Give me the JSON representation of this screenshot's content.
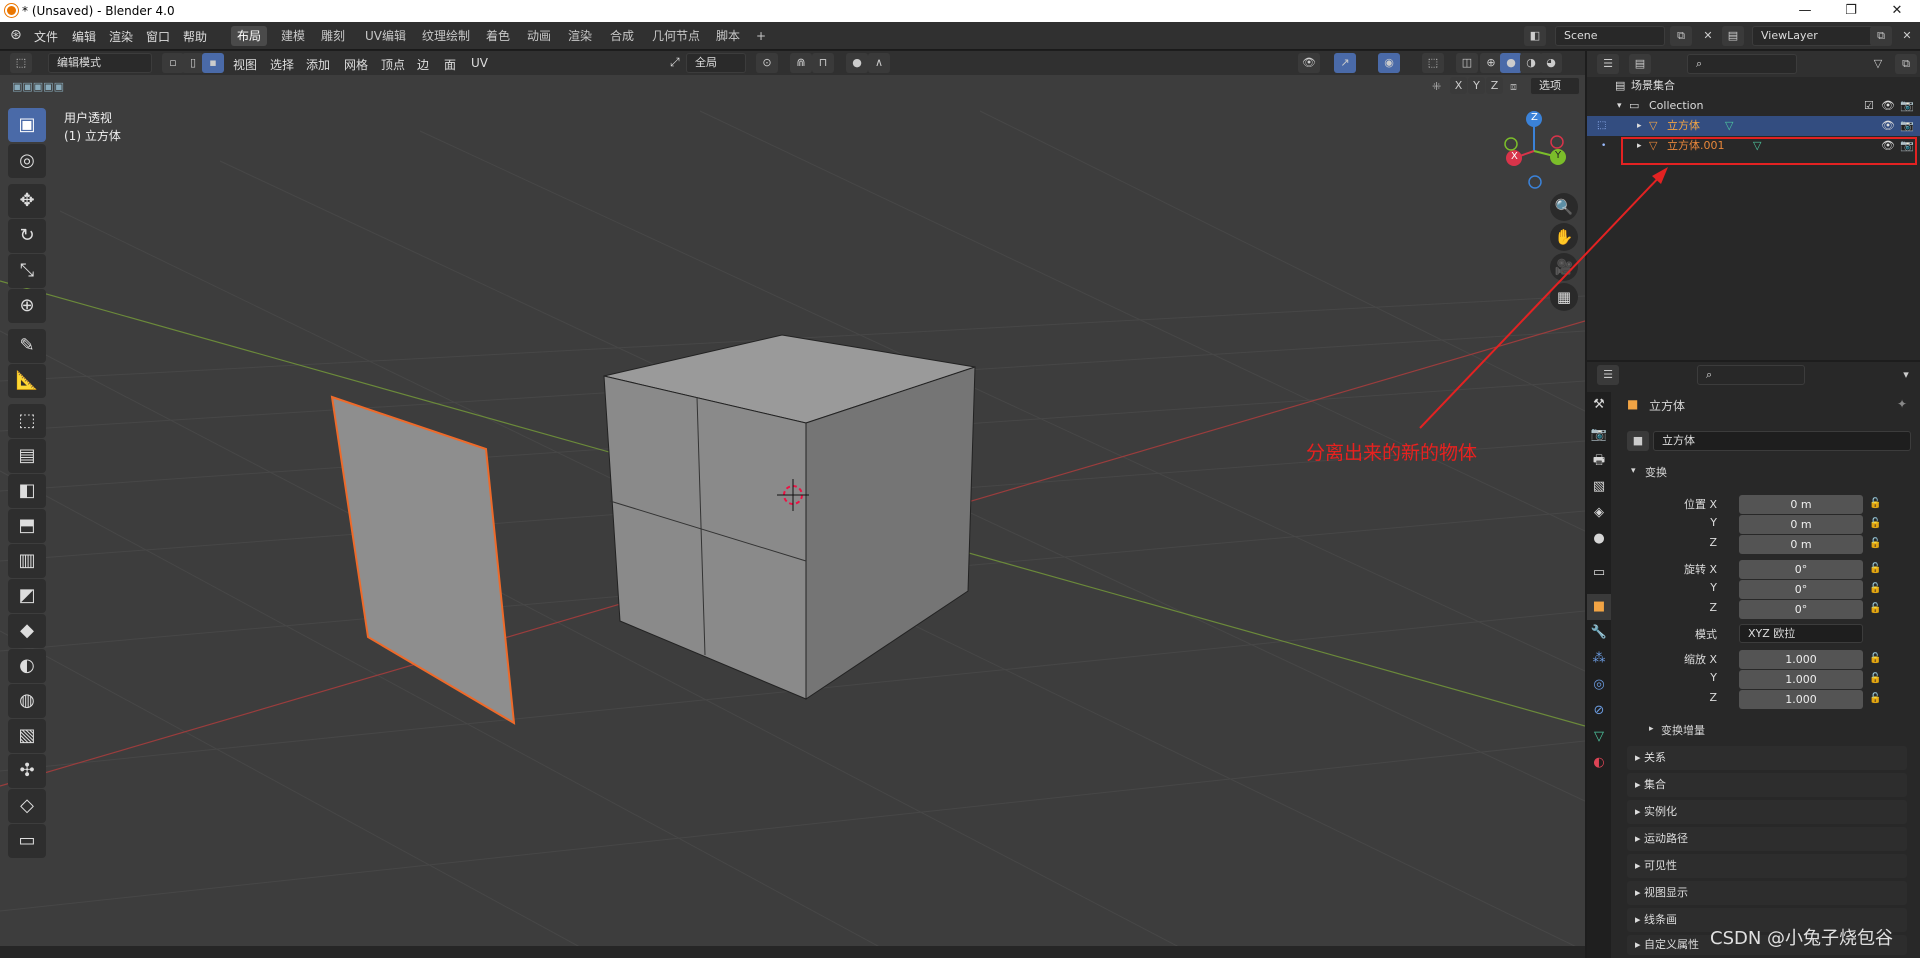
{
  "window": {
    "title": "* (Unsaved) - Blender 4.0",
    "min": "—",
    "max": "❐",
    "close": "✕"
  },
  "menus": [
    "文件",
    "编辑",
    "渲染",
    "窗口",
    "帮助"
  ],
  "workspaces": [
    "布局",
    "建模",
    "雕刻",
    "UV编辑",
    "纹理绘制",
    "着色",
    "动画",
    "渲染",
    "合成",
    "几何节点",
    "脚本",
    "+"
  ],
  "scene": {
    "name": "Scene",
    "view_layer": "ViewLayer"
  },
  "viewport_header": {
    "mode": "编辑模式",
    "menus": [
      "视图",
      "选择",
      "添加",
      "网格",
      "顶点",
      "边",
      "面",
      "UV"
    ],
    "transform_orientation": "全局",
    "options": "选项",
    "axes": [
      "X",
      "Y",
      "Z"
    ]
  },
  "viewport": {
    "view_name": "用户透视",
    "object_name": "(1) 立方体"
  },
  "gizmo": {
    "x": "X",
    "y": "Y",
    "z": "Z"
  },
  "tools": [
    "▣",
    "◎",
    "✥",
    "↻",
    "⤡",
    "⊕",
    "✎",
    "📐",
    "⬚",
    "▤",
    "◧",
    "⬒",
    "▥",
    "◩",
    "◆",
    "◐",
    "◍",
    "▧",
    "✣",
    "◇",
    "▭"
  ],
  "nav_icons": [
    "🔍",
    "✋",
    "🎥",
    "▦"
  ],
  "outliner": {
    "scene_collection": "场景集合",
    "collection": "Collection",
    "items": [
      {
        "name": "立方体",
        "color": "#f2a444"
      },
      {
        "name": "立方体.001",
        "color": "#e8873a"
      }
    ]
  },
  "properties": {
    "object_name": "立方体",
    "data_name": "立方体",
    "transform_label": "变换",
    "location": {
      "label": "位置",
      "axes": [
        "X",
        "Y",
        "Z"
      ],
      "values": [
        "0 m",
        "0 m",
        "0 m"
      ]
    },
    "rotation": {
      "label": "旋转",
      "axes": [
        "X",
        "Y",
        "Z"
      ],
      "values": [
        "0°",
        "0°",
        "0°"
      ]
    },
    "mode": {
      "label": "模式",
      "value": "XYZ 欧拉"
    },
    "scale": {
      "label": "缩放",
      "axes": [
        "X",
        "Y",
        "Z"
      ],
      "values": [
        "1.000",
        "1.000",
        "1.000"
      ]
    },
    "delta_transform": "变换增量",
    "sections": [
      "关系",
      "集合",
      "实例化",
      "运动路径",
      "可见性",
      "视图显示",
      "线条画",
      "自定义属性"
    ]
  },
  "annotation": {
    "text": "分离出来的新的物体",
    "color": "#e8211f"
  },
  "watermark": "CSDN @小兔子烧包谷",
  "colors": {
    "accent": "#4a6aa8",
    "selection_orange": "#ee6a2a",
    "annotation_red": "#e32222"
  }
}
